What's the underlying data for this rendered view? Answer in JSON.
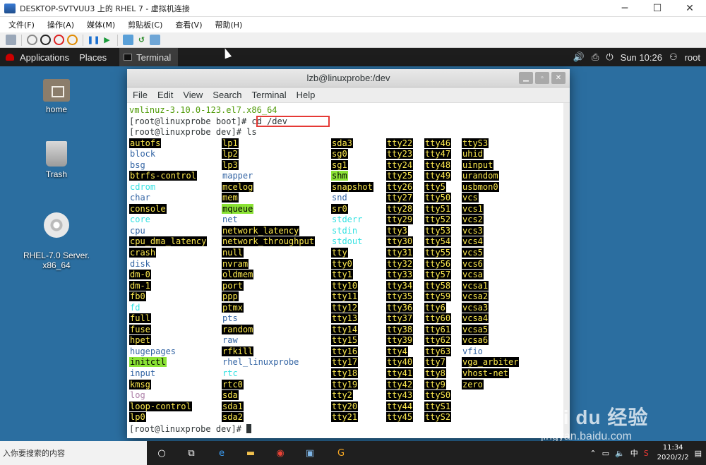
{
  "host": {
    "title": "DESKTOP-SVTVUU3 上的 RHEL 7 - 虚拟机连接",
    "menu": [
      "文件(F)",
      "操作(A)",
      "媒体(M)",
      "剪贴板(C)",
      "查看(V)",
      "帮助(H)"
    ],
    "window_controls": {
      "min": "─",
      "max": "☐",
      "close": "✕"
    }
  },
  "guest_panel": {
    "applications": "Applications",
    "places": "Places",
    "terminal_tab": "Terminal",
    "time": "Sun 10:26",
    "user": "root"
  },
  "desktop_icons": [
    {
      "label": "home",
      "icon": "folder-home-icon"
    },
    {
      "label": "Trash",
      "icon": "trash-icon"
    },
    {
      "label": "RHEL-7.0 Server.\nx86_64",
      "icon": "dvd-icon"
    }
  ],
  "terminal": {
    "title": "lzb@linuxprobe:/dev",
    "menu": [
      "File",
      "Edit",
      "View",
      "Search",
      "Terminal",
      "Help"
    ],
    "line1": "vmlinuz-3.10.0-123.el7.x86_64",
    "prompt_boot": "[root@linuxprobe boot]# ",
    "cmd1": "cd /dev",
    "prompt_dev": "[root@linuxprobe dev]# ",
    "cmd2": "ls",
    "final_prompt": "[root@linuxprobe dev]# ",
    "ls_columns": [
      [
        {
          "t": "autofs",
          "k": "blk"
        },
        {
          "t": "block",
          "k": "blue"
        },
        {
          "t": "bsg",
          "k": "blue"
        },
        {
          "t": "btrfs-control",
          "k": "blk"
        },
        {
          "t": "cdrom",
          "k": "link"
        },
        {
          "t": "char",
          "k": "blue"
        },
        {
          "t": "console",
          "k": "blk"
        },
        {
          "t": "core",
          "k": "link"
        },
        {
          "t": "cpu",
          "k": "blue"
        },
        {
          "t": "cpu_dma_latency",
          "k": "blk"
        },
        {
          "t": "crash",
          "k": "blk"
        },
        {
          "t": "disk",
          "k": "blue"
        },
        {
          "t": "dm-0",
          "k": "blk"
        },
        {
          "t": "dm-1",
          "k": "blk"
        },
        {
          "t": "fb0",
          "k": "blk"
        },
        {
          "t": "fd",
          "k": "link"
        },
        {
          "t": "full",
          "k": "blk"
        },
        {
          "t": "fuse",
          "k": "blk"
        },
        {
          "t": "hpet",
          "k": "blk"
        },
        {
          "t": "hugepages",
          "k": "blue"
        },
        {
          "t": "initctl",
          "k": "grn"
        },
        {
          "t": "input",
          "k": "blue"
        },
        {
          "t": "kmsg",
          "k": "blk"
        },
        {
          "t": "log",
          "k": "pink"
        },
        {
          "t": "loop-control",
          "k": "blk"
        },
        {
          "t": "lp0",
          "k": "blk"
        }
      ],
      [
        {
          "t": "lp1",
          "k": "blk"
        },
        {
          "t": "lp2",
          "k": "blk"
        },
        {
          "t": "lp3",
          "k": "blk"
        },
        {
          "t": "mapper",
          "k": "blue"
        },
        {
          "t": "mcelog",
          "k": "blk"
        },
        {
          "t": "mem",
          "k": "blk"
        },
        {
          "t": "mqueue",
          "k": "grn"
        },
        {
          "t": "net",
          "k": "blue"
        },
        {
          "t": "network_latency",
          "k": "blk"
        },
        {
          "t": "network_throughput",
          "k": "blk"
        },
        {
          "t": "null",
          "k": "blk"
        },
        {
          "t": "nvram",
          "k": "blk"
        },
        {
          "t": "oldmem",
          "k": "blk"
        },
        {
          "t": "port",
          "k": "blk"
        },
        {
          "t": "ppp",
          "k": "blk"
        },
        {
          "t": "ptmx",
          "k": "blk"
        },
        {
          "t": "pts",
          "k": "blue"
        },
        {
          "t": "random",
          "k": "blk"
        },
        {
          "t": "raw",
          "k": "blue"
        },
        {
          "t": "rfkill",
          "k": "blk"
        },
        {
          "t": "rhel_linuxprobe",
          "k": "blue"
        },
        {
          "t": "rtc",
          "k": "link"
        },
        {
          "t": "rtc0",
          "k": "blk"
        },
        {
          "t": "sda",
          "k": "blk"
        },
        {
          "t": "sda1",
          "k": "blk"
        },
        {
          "t": "sda2",
          "k": "blk"
        }
      ],
      [
        {
          "t": "sda3",
          "k": "blk"
        },
        {
          "t": "sg0",
          "k": "blk"
        },
        {
          "t": "sg1",
          "k": "blk"
        },
        {
          "t": "shm",
          "k": "grn"
        },
        {
          "t": "snapshot",
          "k": "blk"
        },
        {
          "t": "snd",
          "k": "blue"
        },
        {
          "t": "sr0",
          "k": "blk"
        },
        {
          "t": "stderr",
          "k": "link"
        },
        {
          "t": "stdin",
          "k": "link"
        },
        {
          "t": "stdout",
          "k": "link"
        },
        {
          "t": "tty",
          "k": "blk"
        },
        {
          "t": "tty0",
          "k": "blk"
        },
        {
          "t": "tty1",
          "k": "blk"
        },
        {
          "t": "tty10",
          "k": "blk"
        },
        {
          "t": "tty11",
          "k": "blk"
        },
        {
          "t": "tty12",
          "k": "blk"
        },
        {
          "t": "tty13",
          "k": "blk"
        },
        {
          "t": "tty14",
          "k": "blk"
        },
        {
          "t": "tty15",
          "k": "blk"
        },
        {
          "t": "tty16",
          "k": "blk"
        },
        {
          "t": "tty17",
          "k": "blk"
        },
        {
          "t": "tty18",
          "k": "blk"
        },
        {
          "t": "tty19",
          "k": "blk"
        },
        {
          "t": "tty2",
          "k": "blk"
        },
        {
          "t": "tty20",
          "k": "blk"
        },
        {
          "t": "tty21",
          "k": "blk"
        }
      ],
      [
        {
          "t": "tty22",
          "k": "blk"
        },
        {
          "t": "tty23",
          "k": "blk"
        },
        {
          "t": "tty24",
          "k": "blk"
        },
        {
          "t": "tty25",
          "k": "blk"
        },
        {
          "t": "tty26",
          "k": "blk"
        },
        {
          "t": "tty27",
          "k": "blk"
        },
        {
          "t": "tty28",
          "k": "blk"
        },
        {
          "t": "tty29",
          "k": "blk"
        },
        {
          "t": "tty3",
          "k": "blk"
        },
        {
          "t": "tty30",
          "k": "blk"
        },
        {
          "t": "tty31",
          "k": "blk"
        },
        {
          "t": "tty32",
          "k": "blk"
        },
        {
          "t": "tty33",
          "k": "blk"
        },
        {
          "t": "tty34",
          "k": "blk"
        },
        {
          "t": "tty35",
          "k": "blk"
        },
        {
          "t": "tty36",
          "k": "blk"
        },
        {
          "t": "tty37",
          "k": "blk"
        },
        {
          "t": "tty38",
          "k": "blk"
        },
        {
          "t": "tty39",
          "k": "blk"
        },
        {
          "t": "tty4",
          "k": "blk"
        },
        {
          "t": "tty40",
          "k": "blk"
        },
        {
          "t": "tty41",
          "k": "blk"
        },
        {
          "t": "tty42",
          "k": "blk"
        },
        {
          "t": "tty43",
          "k": "blk"
        },
        {
          "t": "tty44",
          "k": "blk"
        },
        {
          "t": "tty45",
          "k": "blk"
        }
      ],
      [
        {
          "t": "tty46",
          "k": "blk"
        },
        {
          "t": "tty47",
          "k": "blk"
        },
        {
          "t": "tty48",
          "k": "blk"
        },
        {
          "t": "tty49",
          "k": "blk"
        },
        {
          "t": "tty5",
          "k": "blk"
        },
        {
          "t": "tty50",
          "k": "blk"
        },
        {
          "t": "tty51",
          "k": "blk"
        },
        {
          "t": "tty52",
          "k": "blk"
        },
        {
          "t": "tty53",
          "k": "blk"
        },
        {
          "t": "tty54",
          "k": "blk"
        },
        {
          "t": "tty55",
          "k": "blk"
        },
        {
          "t": "tty56",
          "k": "blk"
        },
        {
          "t": "tty57",
          "k": "blk"
        },
        {
          "t": "tty58",
          "k": "blk"
        },
        {
          "t": "tty59",
          "k": "blk"
        },
        {
          "t": "tty6",
          "k": "blk"
        },
        {
          "t": "tty60",
          "k": "blk"
        },
        {
          "t": "tty61",
          "k": "blk"
        },
        {
          "t": "tty62",
          "k": "blk"
        },
        {
          "t": "tty63",
          "k": "blk"
        },
        {
          "t": "tty7",
          "k": "blk"
        },
        {
          "t": "tty8",
          "k": "blk"
        },
        {
          "t": "tty9",
          "k": "blk"
        },
        {
          "t": "ttyS0",
          "k": "blk"
        },
        {
          "t": "ttyS1",
          "k": "blk"
        },
        {
          "t": "ttyS2",
          "k": "blk"
        }
      ],
      [
        {
          "t": "ttyS3",
          "k": "blk"
        },
        {
          "t": "uhid",
          "k": "blk"
        },
        {
          "t": "uinput",
          "k": "blk"
        },
        {
          "t": "urandom",
          "k": "blk"
        },
        {
          "t": "usbmon0",
          "k": "blk"
        },
        {
          "t": "vcs",
          "k": "blk"
        },
        {
          "t": "vcs1",
          "k": "blk"
        },
        {
          "t": "vcs2",
          "k": "blk"
        },
        {
          "t": "vcs3",
          "k": "blk"
        },
        {
          "t": "vcs4",
          "k": "blk"
        },
        {
          "t": "vcs5",
          "k": "blk"
        },
        {
          "t": "vcs6",
          "k": "blk"
        },
        {
          "t": "vcsa",
          "k": "blk"
        },
        {
          "t": "vcsa1",
          "k": "blk"
        },
        {
          "t": "vcsa2",
          "k": "blk"
        },
        {
          "t": "vcsa3",
          "k": "blk"
        },
        {
          "t": "vcsa4",
          "k": "blk"
        },
        {
          "t": "vcsa5",
          "k": "blk"
        },
        {
          "t": "vcsa6",
          "k": "blk"
        },
        {
          "t": "vfio",
          "k": "blue"
        },
        {
          "t": "vga_arbiter",
          "k": "blk"
        },
        {
          "t": "vhost-net",
          "k": "blk"
        },
        {
          "t": "zero",
          "k": "blk"
        }
      ]
    ]
  },
  "taskbar": {
    "search_placeholder": "入你要搜索的内容",
    "ime": "中",
    "time": "11:34",
    "date": "2020/2/2"
  },
  "watermark": {
    "brand": "Bai du 经验",
    "site": "jingyan.baidu.com"
  },
  "colors": {
    "desktop": "#2b6ea0",
    "terminal_bg": "#ffffff",
    "highlight_black": "#000000",
    "highlight_green": "#8ae234",
    "redbox": "#e53935"
  }
}
